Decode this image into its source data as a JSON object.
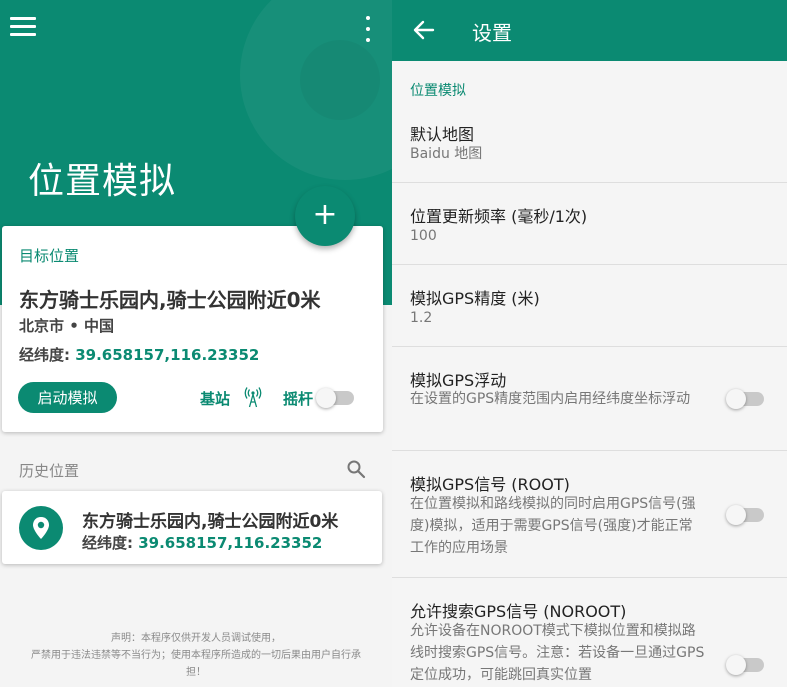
{
  "colors": {
    "primary": "#0b8a72",
    "background": "#f4f4f4"
  },
  "left": {
    "icons": {
      "menu": "menu-icon",
      "more": "more-vert-icon",
      "add": "plus-icon",
      "tower": "cell-tower-icon",
      "search": "search-icon",
      "pin": "location-pin-icon"
    },
    "title": "位置模拟",
    "fab_label": "+",
    "target": {
      "section_label": "目标位置",
      "place": "东方骑士乐园内,骑士公园附近0米",
      "region": "北京市 • 中国",
      "coords_label": "经纬度:",
      "coords_value": "39.658157,116.23352",
      "start_button": "启动模拟",
      "cell_label": "基站",
      "joystick_label": "摇杆",
      "joystick_on": false
    },
    "history": {
      "label": "历史位置",
      "items": [
        {
          "name": "东方骑士乐园内,骑士公园附近0米",
          "coords_label": "经纬度:",
          "coords_value": "39.658157,116.23352"
        }
      ]
    },
    "disclaimer": [
      "声明：本程序仅供开发人员调试使用，",
      "严禁用于违法违禁等不当行为；使用本程序所造成的一切后果由用户自行承",
      "担！"
    ]
  },
  "right": {
    "title": "设置",
    "category": "位置模拟",
    "prefs": [
      {
        "title": "默认地图",
        "summary": "Baidu 地图"
      },
      {
        "title": "位置更新频率 (毫秒/1次)",
        "summary": "100"
      },
      {
        "title": "模拟GPS精度 (米)",
        "summary": "1.2"
      },
      {
        "title": "模拟GPS浮动",
        "summary": "在设置的GPS精度范围内启用经纬度坐标浮动",
        "switch_on": false
      },
      {
        "title": "模拟GPS信号 (ROOT)",
        "summary": "在位置模拟和路线模拟的同时启用GPS信号(强度)模拟，适用于需要GPS信号(强度)才能正常工作的应用场景",
        "switch_on": false
      },
      {
        "title": "允许搜索GPS信号 (NOROOT)",
        "summary": "允许设备在NOROOT模式下模拟位置和模拟路线时搜索GPS信号。注意：若设备一旦通过GPS定位成功，可能跳回真实位置",
        "switch_on": false
      }
    ]
  }
}
